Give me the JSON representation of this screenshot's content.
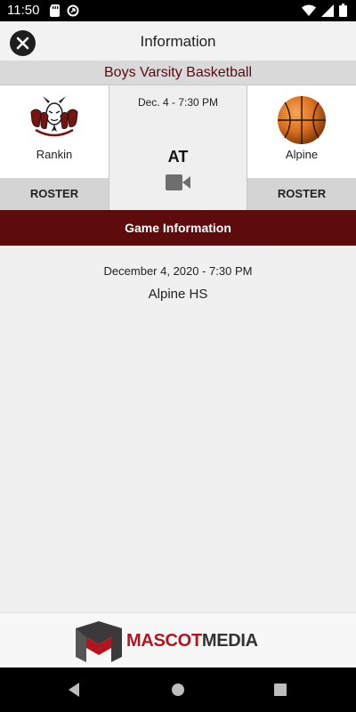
{
  "status": {
    "time": "11:50"
  },
  "header": {
    "title": "Information"
  },
  "sport": "Boys Varsity Basketball",
  "home_team": {
    "name": "Rankin",
    "roster_label": "ROSTER",
    "logo_icon": "devils-logo"
  },
  "away_team": {
    "name": "Alpine",
    "roster_label": "ROSTER",
    "logo_icon": "basketball-logo"
  },
  "matchup": {
    "date_short": "Dec. 4 - 7:30 PM",
    "vs_label": "AT",
    "video_icon": "video-camera-icon"
  },
  "section": {
    "title": "Game Information"
  },
  "game": {
    "datetime": "December 4, 2020 - 7:30 PM",
    "location": "Alpine HS"
  },
  "footer": {
    "brand_part1": "MASCOT",
    "brand_part2": "MEDIA"
  },
  "colors": {
    "accent": "#5e0b0b",
    "brand_red": "#b3141f"
  }
}
